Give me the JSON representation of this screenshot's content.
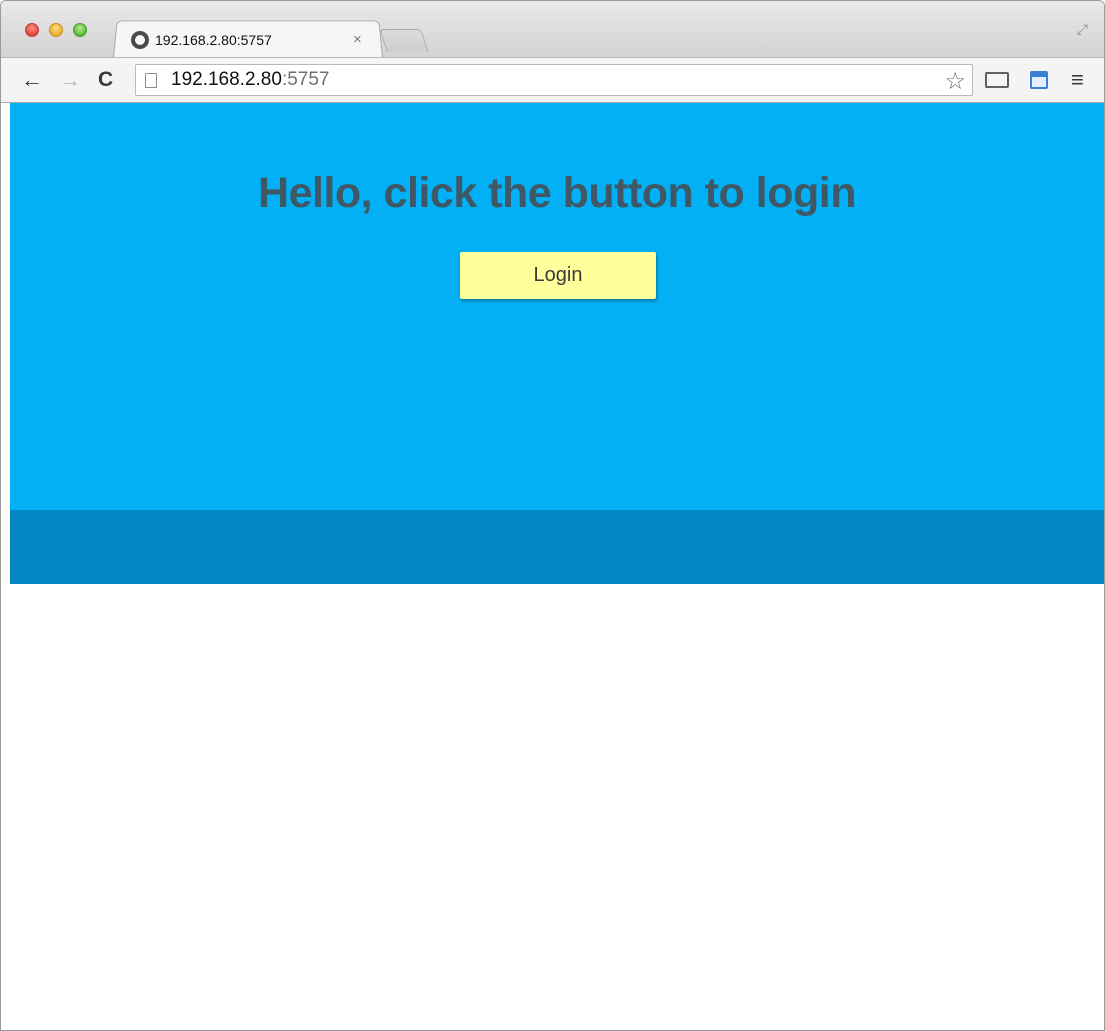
{
  "browser": {
    "tab_title": "192.168.2.80:5757",
    "tab_close": "×",
    "url_host": "192.168.2.80",
    "url_port": ":5757"
  },
  "icons": {
    "back": "←",
    "forward": "→",
    "reload": "C",
    "star": "☆",
    "menu": "≡",
    "fullscreen": "⤢"
  },
  "page": {
    "title": "Hello, click the button to login",
    "login_label": "Login"
  },
  "colors": {
    "hero_bg": "#03b0f5",
    "footer_band": "#0486c3",
    "button_bg": "#ffff9c",
    "title_text": "#3f5865"
  }
}
